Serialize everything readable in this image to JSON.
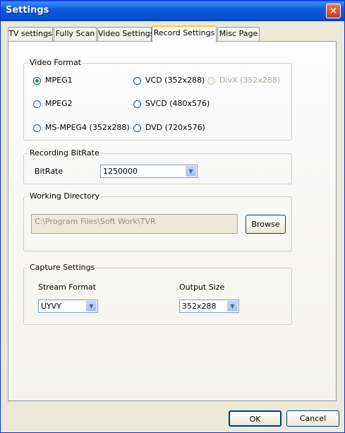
{
  "window": {
    "title": "Settings",
    "close_glyph": "✕"
  },
  "tabs": [
    "TV settings",
    "Fully Scan",
    "Video Settings",
    "Record Settings",
    "Misc Page"
  ],
  "active_tab": "Record Settings",
  "video_format": {
    "legend": "Video Format",
    "options": [
      "MPEG1",
      "MPEG2",
      "MS-MPEG4 (352x288)",
      "VCD (352x288)",
      "SVCD (480x576)",
      "DVD (720x576)",
      "DivX (352x288)"
    ],
    "selected": "MPEG1",
    "disabled": [
      "DivX (352x288)"
    ]
  },
  "recording_bitrate": {
    "legend": "Recording BitRate",
    "label": "BitRate",
    "value": "1250000"
  },
  "working_directory": {
    "legend": "Working Directory",
    "path": "C:\\Program Files\\Soft Work\\TVR",
    "browse_label": "Browse"
  },
  "capture_settings": {
    "legend": "Capture Settings",
    "stream_format_label": "Stream Format",
    "stream_format_value": "UYVY",
    "output_size_label": "Output Size",
    "output_size_value": "352x288"
  },
  "footer": {
    "ok_label": "OK",
    "cancel_label": "Cancel"
  },
  "icons": {
    "dropdown_arrow": "▼"
  },
  "colors": {
    "titlebar": "#0a5fe8",
    "face": "#ece9d8",
    "active_tab_accent": "#ffc83c"
  }
}
